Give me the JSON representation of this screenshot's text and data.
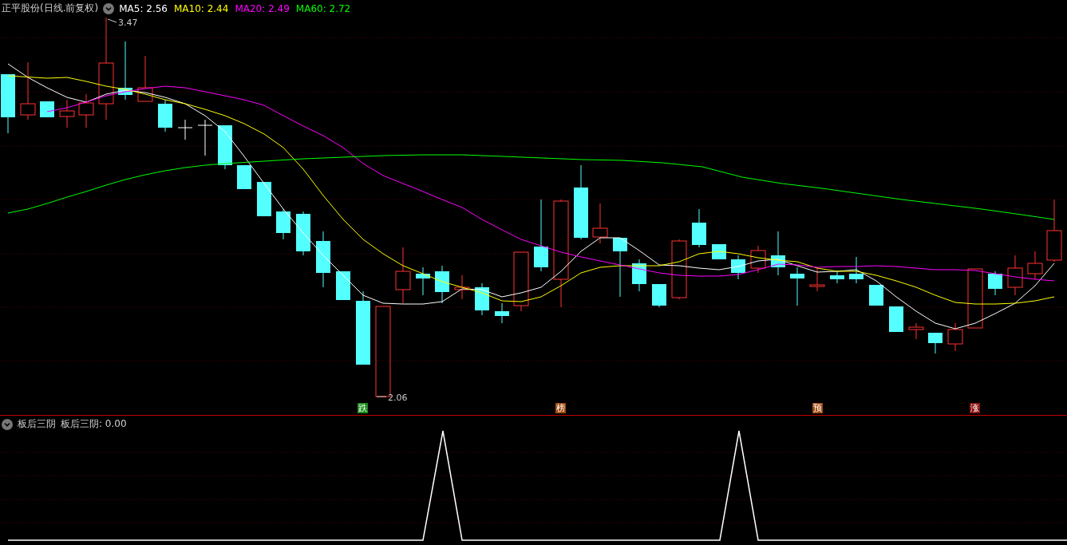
{
  "price_panel": {
    "title": "正平股份(日线.前复权)",
    "moving_averages": [
      {
        "label": "MA5: 2.56",
        "color": "#ffffff"
      },
      {
        "label": "MA10: 2.44",
        "color": "#ffff00"
      },
      {
        "label": "MA20: 2.49",
        "color": "#ff00ff"
      },
      {
        "label": "MA60: 2.72",
        "color": "#00ff00"
      }
    ],
    "high_label": "3.47",
    "low_label": "2.06",
    "signal_badges": [
      {
        "label": "跌",
        "color": "#1a8a1a"
      },
      {
        "label": "榜",
        "color": "#a04a10"
      },
      {
        "label": "预",
        "color": "#a04a10"
      },
      {
        "label": "涨",
        "color": "#8a1010"
      }
    ]
  },
  "indicator_panel": {
    "name": "板后三阴",
    "reading": "板后三阴: 0.00"
  }
}
